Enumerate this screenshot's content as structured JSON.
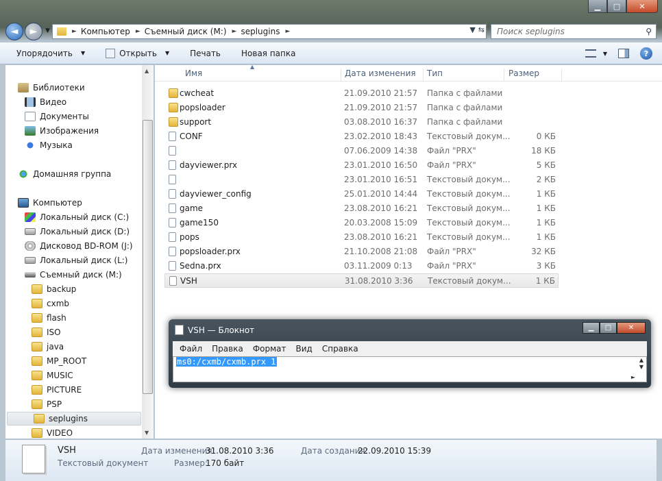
{
  "window": {
    "caption": {
      "minimize": "▁",
      "maximize": "□",
      "close": "✕"
    }
  },
  "nav": {
    "breadcrumbs": [
      "Компьютер",
      "Съемный диск (M:)",
      "seplugins"
    ],
    "search_placeholder": "Поиск seplugins"
  },
  "toolbar": {
    "organize": "Упорядочить",
    "open": "Открыть",
    "print": "Печать",
    "new_folder": "Новая папка",
    "help": "?"
  },
  "sidebar": {
    "items": [
      {
        "label": "Библиотеки",
        "icon": "library-icon",
        "level": 0
      },
      {
        "label": "Видео",
        "icon": "video-icon",
        "level": 1
      },
      {
        "label": "Документы",
        "icon": "documents-icon",
        "level": 1
      },
      {
        "label": "Изображения",
        "icon": "pictures-icon",
        "level": 1
      },
      {
        "label": "Музыка",
        "icon": "music-icon",
        "level": 1
      },
      {
        "label": "Домашняя группа",
        "icon": "homegroup-icon",
        "level": 0
      },
      {
        "label": "Компьютер",
        "icon": "computer-icon",
        "level": 0
      },
      {
        "label": "Локальный диск (C:)",
        "icon": "windows-drive-icon",
        "level": 1
      },
      {
        "label": "Локальный диск (D:)",
        "icon": "drive-icon",
        "level": 1
      },
      {
        "label": "Дисковод BD-ROM (J:)",
        "icon": "bd-rom-icon",
        "level": 1
      },
      {
        "label": "Локальный диск (L:)",
        "icon": "drive-icon",
        "level": 1
      },
      {
        "label": "Съемный диск (M:)",
        "icon": "removable-drive-icon",
        "level": 1
      },
      {
        "label": "backup",
        "icon": "folder-icon",
        "level": 2
      },
      {
        "label": "cxmb",
        "icon": "folder-icon",
        "level": 2
      },
      {
        "label": "flash",
        "icon": "folder-icon",
        "level": 2
      },
      {
        "label": "ISO",
        "icon": "folder-icon",
        "level": 2
      },
      {
        "label": "java",
        "icon": "folder-icon",
        "level": 2
      },
      {
        "label": "MP_ROOT",
        "icon": "folder-icon",
        "level": 2
      },
      {
        "label": "MUSIC",
        "icon": "folder-icon",
        "level": 2
      },
      {
        "label": "PICTURE",
        "icon": "folder-icon",
        "level": 2
      },
      {
        "label": "PSP",
        "icon": "folder-icon",
        "level": 2
      },
      {
        "label": "seplugins",
        "icon": "folder-icon",
        "level": 2,
        "selected": true
      },
      {
        "label": "VIDEO",
        "icon": "folder-icon",
        "level": 2
      }
    ]
  },
  "columns": {
    "name": "Имя",
    "date": "Дата изменения",
    "type": "Тип",
    "size": "Размер"
  },
  "files": [
    {
      "name": "cwcheat",
      "date": "21.09.2010 21:57",
      "type": "Папка с файлами",
      "size": "",
      "icon": "folder-icon"
    },
    {
      "name": "popsloader",
      "date": "21.09.2010 21:57",
      "type": "Папка с файлами",
      "size": "",
      "icon": "folder-icon"
    },
    {
      "name": "support",
      "date": "03.08.2010 16:37",
      "type": "Папка с файлами",
      "size": "",
      "icon": "folder-icon"
    },
    {
      "name": "CONF",
      "date": "23.02.2010 18:43",
      "type": "Текстовый докум...",
      "size": "0 КБ",
      "icon": "text-file-icon"
    },
    {
      "name": "",
      "date": "07.06.2009 14:38",
      "type": "Файл \"PRX\"",
      "size": "18 КБ",
      "icon": "file-icon"
    },
    {
      "name": "dayviewer.prx",
      "date": "23.01.2010 16:50",
      "type": "Файл \"PRX\"",
      "size": "5 КБ",
      "icon": "file-icon"
    },
    {
      "name": "",
      "date": "23.01.2010 16:51",
      "type": "Текстовый докум...",
      "size": "2 КБ",
      "icon": "text-file-icon"
    },
    {
      "name": "dayviewer_config",
      "date": "25.01.2010 14:44",
      "type": "Текстовый докум...",
      "size": "1 КБ",
      "icon": "text-file-icon"
    },
    {
      "name": "game",
      "date": "23.08.2010 16:21",
      "type": "Текстовый докум...",
      "size": "1 КБ",
      "icon": "text-file-icon"
    },
    {
      "name": "game150",
      "date": "20.03.2008 15:09",
      "type": "Текстовый докум...",
      "size": "1 КБ",
      "icon": "text-file-icon"
    },
    {
      "name": "pops",
      "date": "23.08.2010 16:21",
      "type": "Текстовый докум...",
      "size": "1 КБ",
      "icon": "text-file-icon"
    },
    {
      "name": "popsloader.prx",
      "date": "21.10.2008 21:08",
      "type": "Файл \"PRX\"",
      "size": "32 КБ",
      "icon": "file-icon"
    },
    {
      "name": "Sedna.prx",
      "date": "03.11.2009 0:13",
      "type": "Файл \"PRX\"",
      "size": "3 КБ",
      "icon": "file-icon"
    },
    {
      "name": "VSH",
      "date": "31.08.2010 3:36",
      "type": "Текстовый докум...",
      "size": "1 КБ",
      "icon": "text-file-icon",
      "selected": true
    }
  ],
  "notepad": {
    "title": "VSH — Блокнот",
    "menu": [
      "Файл",
      "Правка",
      "Формат",
      "Вид",
      "Справка"
    ],
    "content": "ms0:/cxmb/cxmb.prx 1"
  },
  "details": {
    "name": "VSH",
    "kind": "Текстовый документ",
    "modified_label": "Дата изменения:",
    "modified_value": "31.08.2010 3:36",
    "size_label": "Размер:",
    "size_value": "170 байт",
    "created_label": "Дата создания:",
    "created_value": "22.09.2010 15:39"
  }
}
